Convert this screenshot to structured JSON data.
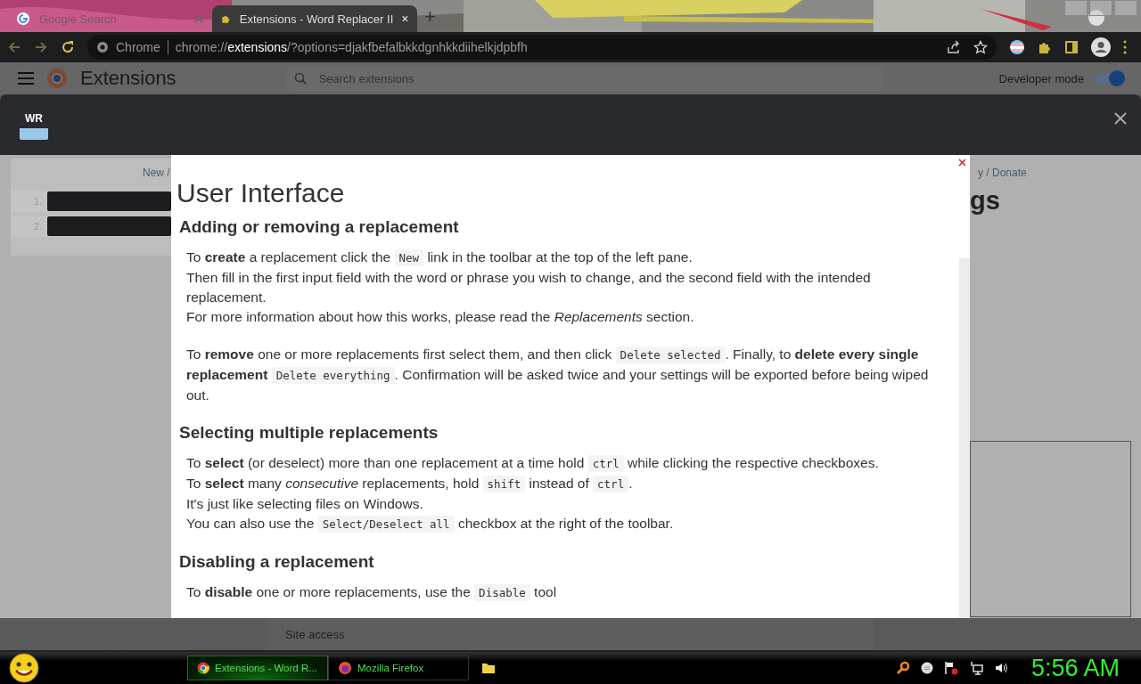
{
  "tabs": [
    {
      "title": "Google Search",
      "selected": false
    },
    {
      "title": "Extensions - Word Replacer II",
      "selected": true
    }
  ],
  "new_tab": "+",
  "omnibox": {
    "site_label": "Chrome",
    "url_scheme": "chrome://",
    "url_host": "extensions",
    "url_rest": "/?options=djakfbefalbkkdgnhkkdiihelkjdpbfh"
  },
  "extensions_page": {
    "title": "Extensions",
    "search": {
      "placeholder": "Search extensions"
    },
    "developer_mode": {
      "label": "Developer mode",
      "on": true
    },
    "site_access": "Site access"
  },
  "options_dialog": {
    "logo": "WR",
    "toolbar_text": "New /",
    "rows": [
      {
        "number": "1."
      },
      {
        "number": "2."
      }
    ],
    "links_text": "y / Donate",
    "heading": "gs"
  },
  "help": {
    "title": "User Interface",
    "sections": [
      {
        "heading": "Adding or removing a replacement",
        "paragraphs": [
          [
            [
              {
                "text": "To **create** a replacement click the "
              },
              {
                "code": "New"
              },
              {
                "text": " link in the toolbar at the top of the left pane."
              }
            ],
            [
              {
                "text": "Then fill in the first input field with the word or phrase you wish to change, and the second field with the intended replacement."
              }
            ],
            [
              {
                "text": "For more information about how this works, please read the *Replacements* section."
              }
            ]
          ],
          [
            [
              {
                "text": "To **remove** one or more replacements first select them, and then click "
              },
              {
                "code": "Delete selected"
              },
              {
                "text": ". Finally, to **delete every single replacement** "
              },
              {
                "code": "Delete everything"
              },
              {
                "text": ". Confirmation will be asked twice and your settings will be exported before being wiped out."
              }
            ]
          ]
        ]
      },
      {
        "heading": "Selecting multiple replacements",
        "paragraphs": [
          [
            [
              {
                "text": "To **select** (or deselect) more than one replacement at a time hold "
              },
              {
                "code": "ctrl"
              },
              {
                "text": " while clicking the respective checkboxes."
              }
            ],
            [
              {
                "text": "To **select** many *consecutive* replacements, hold "
              },
              {
                "code": "shift"
              },
              {
                "text": " instead of "
              },
              {
                "code": "ctrl"
              },
              {
                "text": "."
              }
            ],
            [
              {
                "text": "It's just like selecting files on Windows."
              }
            ],
            [
              {
                "text": "You can also use the "
              },
              {
                "code": "Select/Deselect all"
              },
              {
                "text": " checkbox at the right of the toolbar."
              }
            ]
          ]
        ]
      },
      {
        "heading": "Disabling a replacement",
        "paragraphs": [
          [
            [
              {
                "text": "To **disable** one or more replacements, use the "
              },
              {
                "code": "Disable"
              },
              {
                "text": " tool"
              }
            ]
          ]
        ]
      }
    ]
  },
  "taskbar": {
    "tasks": [
      {
        "title": "Extensions - Word R...",
        "kind": "chrome",
        "selected": true
      },
      {
        "title": "Mozilla Firefox",
        "kind": "firefox",
        "selected": false
      },
      {
        "kind": "folder",
        "selected": false
      }
    ],
    "clock": "5:56 AM"
  }
}
